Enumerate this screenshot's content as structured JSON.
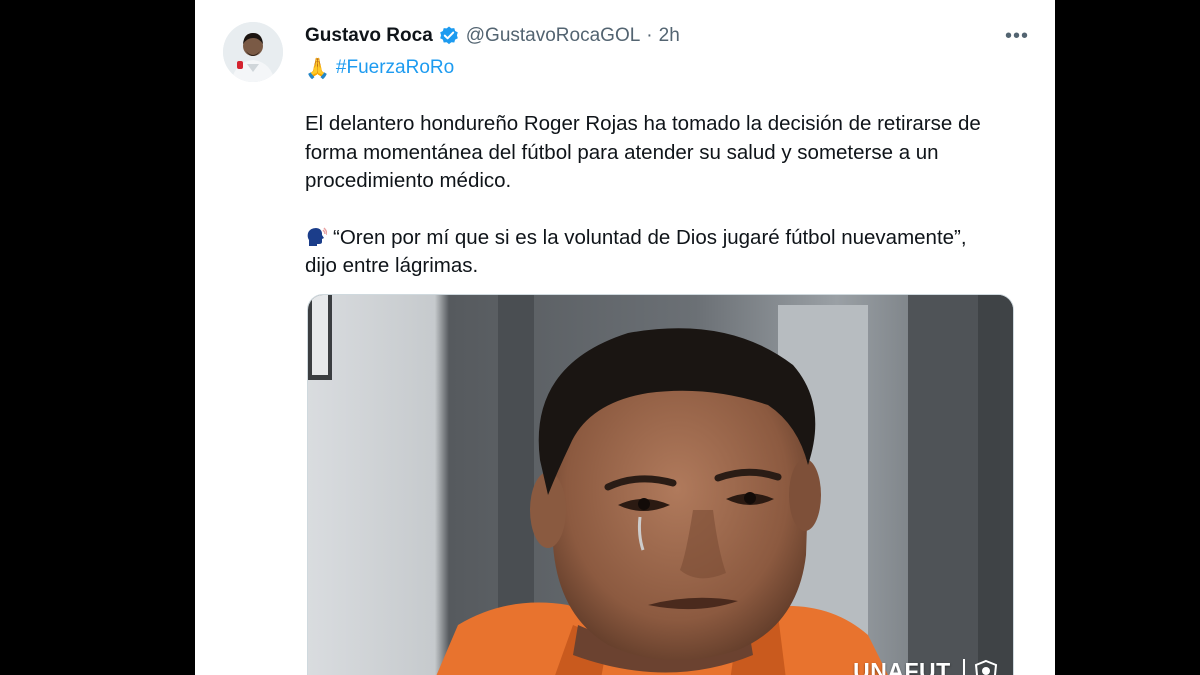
{
  "tweet": {
    "author_name": "Gustavo Roca",
    "handle": "@GustavoRocaGOL",
    "separator": "·",
    "time": "2h",
    "more_label": "•••",
    "hashtag_emoji": "🙏",
    "hashtag": "#FuerzaRoRo",
    "paragraph1": "El delantero hondureño Roger Rojas ha tomado la decisión de retirarse de forma momentánea del fútbol para atender su salud y someterse a un procedimiento médico.",
    "quote": "“Oren por mí que si es la voluntad de Dios jugaré fútbol nuevamente”,",
    "quote_tail": "dijo entre lágrimas.",
    "icons": {
      "verified": "verified-badge-icon",
      "speaking": "speaking-head-icon",
      "more": "more-options-icon"
    }
  },
  "media": {
    "watermark": "UNAFUT.",
    "watermark_logo": "crest-icon"
  },
  "colors": {
    "accent": "#1d9bf0",
    "text": "#0f1419",
    "secondary": "#536471",
    "background": "#000000"
  }
}
